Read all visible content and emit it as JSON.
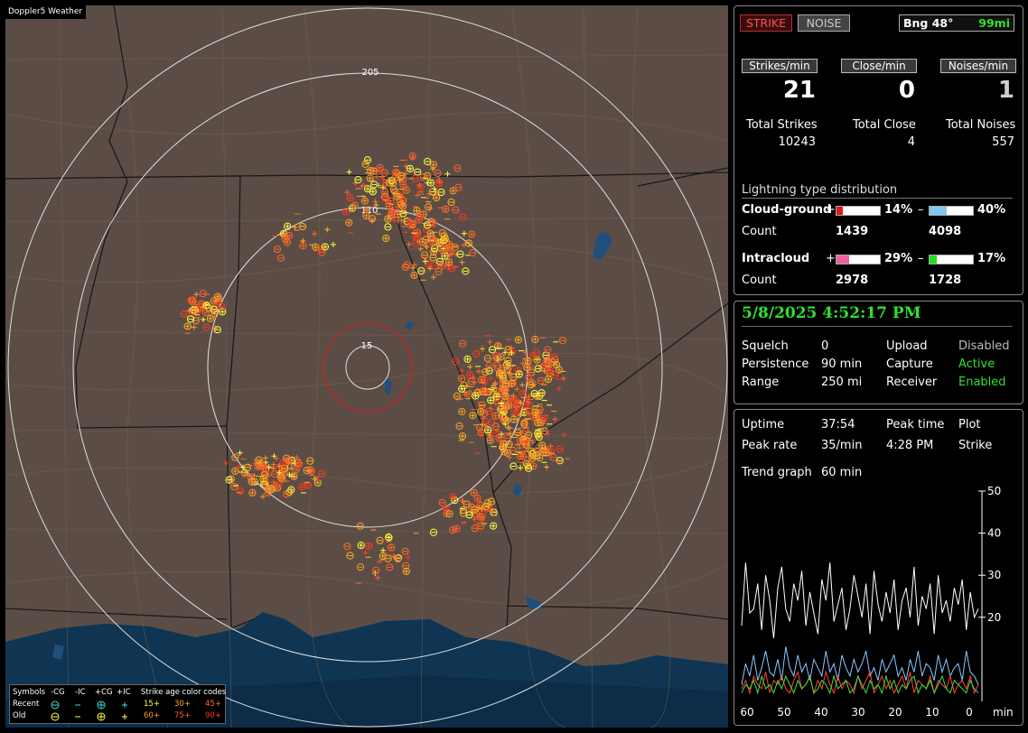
{
  "app": {
    "title": "Doppler5 Weather"
  },
  "map": {
    "range_labels": [
      "205",
      "110",
      "15"
    ],
    "legend": {
      "symbols_label": "Symbols",
      "col_headers": [
        "-CG",
        "-IC",
        "+CG",
        "+IC"
      ],
      "age_title": "Strike age color codes",
      "recent_label": "Recent",
      "old_label": "Old",
      "recent_ages": [
        "15+",
        "30+",
        "45+"
      ],
      "old_ages": [
        "60+",
        "75+",
        "90+"
      ],
      "age_colors": [
        "#ffff40",
        "#ffb020",
        "#ff7020",
        "#ff9a30",
        "#ff6030",
        "#ff3a20"
      ]
    }
  },
  "status": {
    "strike_label": "STRIKE",
    "noise_label": "NOISE",
    "bearing_label": "Bng 48°",
    "distance_label": "99mi"
  },
  "counts": {
    "strikes_header": "Strikes/min",
    "close_header": "Close/min",
    "noises_header": "Noises/min",
    "strikes_value": "21",
    "close_value": "0",
    "noises_value": "1",
    "total_strikes_label": "Total Strikes",
    "total_close_label": "Total Close",
    "total_noises_label": "Total Noises",
    "total_strikes": "10243",
    "total_close": "4",
    "total_noises": "557"
  },
  "distribution": {
    "title": "Lightning type distribution",
    "cg_label": "Cloud-ground",
    "ic_label": "Intracloud",
    "count_label": "Count",
    "plus": "+",
    "minus": "–",
    "cg_pos_pct": "14%",
    "cg_neg_pct": "40%",
    "ic_pos_pct": "29%",
    "ic_neg_pct": "17%",
    "cg_pos_fraction": 0.14,
    "cg_neg_fraction": 0.4,
    "ic_pos_fraction": 0.29,
    "ic_neg_fraction": 0.17,
    "cg_pos_count": "1439",
    "cg_neg_count": "4098",
    "ic_pos_count": "2978",
    "ic_neg_count": "1728",
    "colors": {
      "cg_pos": "#e01818",
      "cg_neg": "#80c8f0",
      "ic_pos": "#f060a0",
      "ic_neg": "#20e020"
    }
  },
  "settings": {
    "datetime": "5/8/2025 4:52:17 PM",
    "squelch_label": "Squelch",
    "squelch_value": "0",
    "persistence_label": "Persistence",
    "persistence_value": "90 min",
    "range_label": "Range",
    "range_value": "250 mi",
    "upload_label": "Upload",
    "upload_value": "Disabled",
    "capture_label": "Capture",
    "capture_value": "Active",
    "receiver_label": "Receiver",
    "receiver_value": "Enabled"
  },
  "stats": {
    "uptime_label": "Uptime",
    "uptime_value": "37:54",
    "peak_time_label": "Peak time",
    "peak_time_value": "4:28 PM",
    "peak_rate_label": "Peak rate",
    "peak_rate_value": "35/min",
    "plot_label": "Plot",
    "plot_value": "Strike",
    "trend_label": "Trend graph",
    "trend_value": "60 min"
  },
  "trend": {
    "y_ticks": [
      "50",
      "40",
      "30",
      "20"
    ],
    "x_ticks": [
      "60",
      "50",
      "40",
      "30",
      "20",
      "10",
      "0"
    ],
    "x_unit": "min",
    "ymax": 50,
    "series": [
      {
        "color": "#ffffff",
        "values": [
          18,
          33,
          21,
          22,
          28,
          17,
          30,
          24,
          15,
          27,
          32,
          22,
          19,
          28,
          24,
          31,
          18,
          26,
          21,
          16,
          29,
          24,
          33,
          19,
          23,
          27,
          17,
          22,
          30,
          25,
          20,
          28,
          16,
          31,
          23,
          19,
          26,
          21,
          29,
          17,
          24,
          27,
          20,
          32,
          18,
          25,
          22,
          28,
          16,
          30,
          21,
          24,
          19,
          27,
          23,
          29,
          17,
          26,
          20,
          22
        ]
      },
      {
        "color": "#8cc8ff",
        "values": [
          4,
          9,
          6,
          11,
          5,
          8,
          12,
          7,
          6,
          10,
          5,
          13,
          8,
          6,
          11,
          7,
          9,
          5,
          10,
          8,
          6,
          12,
          7,
          9,
          5,
          11,
          8,
          6,
          10,
          7,
          9,
          12,
          6,
          8,
          5,
          10,
          7,
          9,
          11,
          6,
          8,
          5,
          10,
          7,
          12,
          6,
          9,
          8,
          5,
          11,
          7,
          10,
          6,
          8,
          9,
          5,
          12,
          7,
          6,
          4
        ]
      },
      {
        "color": "#ff4040",
        "values": [
          3,
          5,
          2,
          6,
          4,
          3,
          7,
          2,
          5,
          4,
          6,
          3,
          2,
          5,
          7,
          3,
          4,
          6,
          2,
          5,
          3,
          7,
          4,
          2,
          6,
          3,
          5,
          4,
          2,
          6,
          3,
          5,
          7,
          2,
          4,
          6,
          3,
          5,
          2,
          4,
          6,
          3,
          7,
          2,
          5,
          4,
          3,
          6,
          2,
          5,
          4,
          3,
          6,
          2,
          4,
          5,
          3,
          6,
          2,
          4
        ]
      },
      {
        "color": "#40e040",
        "values": [
          2,
          4,
          3,
          5,
          2,
          6,
          3,
          4,
          2,
          5,
          3,
          6,
          4,
          2,
          5,
          3,
          4,
          6,
          2,
          3,
          5,
          4,
          2,
          6,
          3,
          4,
          5,
          2,
          3,
          6,
          4,
          2,
          5,
          3,
          4,
          2,
          6,
          3,
          5,
          2,
          4,
          3,
          5,
          6,
          2,
          4,
          3,
          5,
          2,
          4,
          6,
          3,
          2,
          5,
          4,
          3,
          2,
          5,
          3,
          2
        ]
      }
    ]
  }
}
